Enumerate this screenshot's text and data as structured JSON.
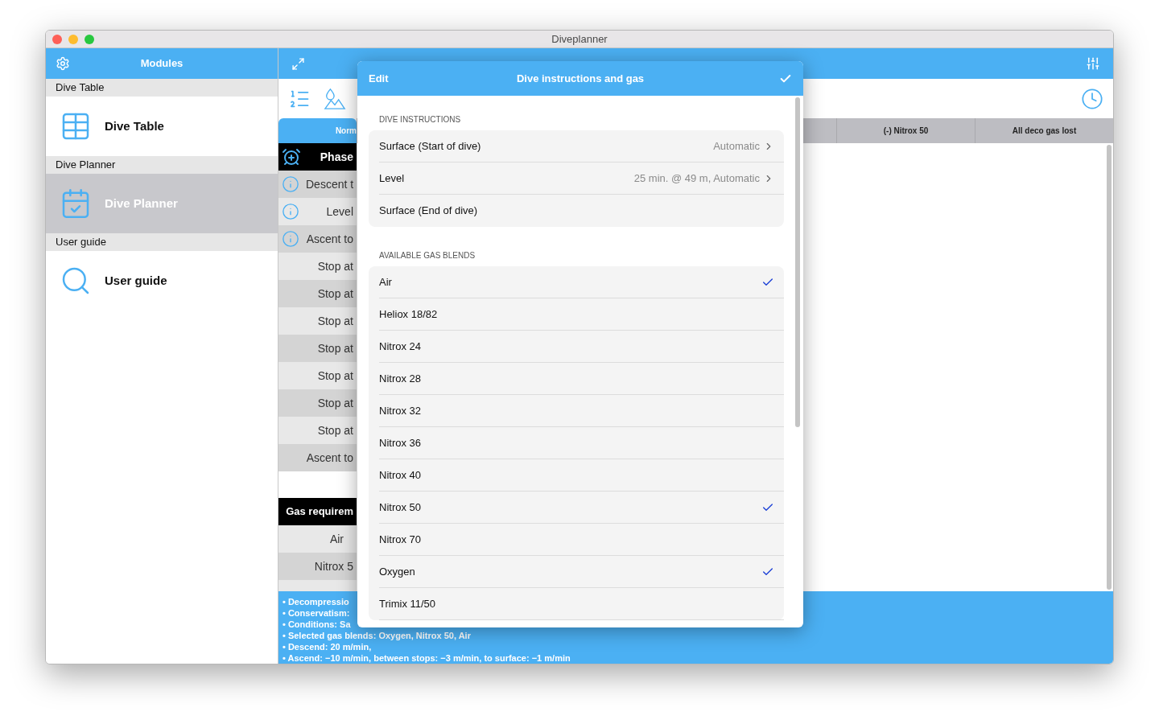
{
  "window": {
    "title": "Diveplanner"
  },
  "sidebar": {
    "title": "Modules",
    "sections": [
      {
        "header": "Dive Table",
        "item": {
          "label": "Dive Table",
          "kind": "table",
          "selected": false
        }
      },
      {
        "header": "Dive Planner",
        "item": {
          "label": "Dive Planner",
          "kind": "planner",
          "selected": true
        }
      },
      {
        "header": "User guide",
        "item": {
          "label": "User guide",
          "kind": "search",
          "selected": false
        }
      }
    ]
  },
  "main": {
    "tabs": [
      {
        "label": "Norm",
        "selected": true
      }
    ],
    "columns": [
      "(-) Nitrox 50",
      "All deco gas lost"
    ],
    "phase_table": {
      "header": "Phase",
      "rows": [
        {
          "label": "Descent t",
          "info": true
        },
        {
          "label": "Level",
          "info": true
        },
        {
          "label": "Ascent to",
          "info": true
        },
        {
          "label": "Stop at",
          "info": false
        },
        {
          "label": "Stop at",
          "info": false
        },
        {
          "label": "Stop at",
          "info": false
        },
        {
          "label": "Stop at",
          "info": false
        },
        {
          "label": "Stop at",
          "info": false
        },
        {
          "label": "Stop at",
          "info": false
        },
        {
          "label": "Stop at",
          "info": false
        },
        {
          "label": "Ascent to",
          "info": false
        }
      ]
    },
    "gas_table": {
      "header": "Gas requirem",
      "rows": [
        "Air",
        "Nitrox 5"
      ]
    },
    "notes": [
      "• Decompressio",
      "• Conservatism:",
      "• Conditions: Sa",
      "• Selected gas blends: Oxygen, Nitrox 50, Air",
      "• Descend: 20 m/min,",
      "• Ascend: −10 m/min, between stops: −3 m/min, to surface: −1 m/min"
    ]
  },
  "modal": {
    "left": "Edit",
    "title": "Dive instructions and gas",
    "sections": [
      {
        "header": "DIVE INSTRUCTIONS",
        "kind": "instructions",
        "rows": [
          {
            "label": "Surface (Start of dive)",
            "value": "Automatic",
            "disclosure": true
          },
          {
            "label": "Level",
            "value": "25 min. @ 49 m, Automatic",
            "disclosure": true
          },
          {
            "label": "Surface (End of dive)",
            "disclosure": false
          }
        ]
      },
      {
        "header": "AVAILABLE GAS BLENDS",
        "kind": "gases",
        "rows": [
          {
            "label": "Air",
            "checked": true
          },
          {
            "label": "Heliox 18/82",
            "checked": false
          },
          {
            "label": "Nitrox 24",
            "checked": false
          },
          {
            "label": "Nitrox 28",
            "checked": false
          },
          {
            "label": "Nitrox 32",
            "checked": false
          },
          {
            "label": "Nitrox 36",
            "checked": false
          },
          {
            "label": "Nitrox 40",
            "checked": false
          },
          {
            "label": "Nitrox 50",
            "checked": true
          },
          {
            "label": "Nitrox 70",
            "checked": false
          },
          {
            "label": "Oxygen",
            "checked": true
          },
          {
            "label": "Trimix 11/50",
            "checked": false
          }
        ]
      }
    ]
  }
}
